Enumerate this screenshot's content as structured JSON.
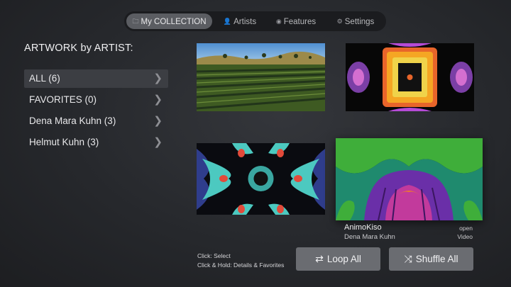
{
  "tabs": [
    {
      "icon": "folder-icon",
      "label": "My COLLECTION",
      "active": true
    },
    {
      "icon": "person-icon",
      "label": "Artists",
      "active": false
    },
    {
      "icon": "eye-icon",
      "label": "Features",
      "active": false
    },
    {
      "icon": "gear-icon",
      "label": "Settings",
      "active": false
    }
  ],
  "sidebar": {
    "heading": "ARTWORK by ARTIST:",
    "items": [
      {
        "label": "ALL (6)",
        "selected": true
      },
      {
        "label": "FAVORITES (0)",
        "selected": false
      },
      {
        "label": "Dena Mara Kuhn (3)",
        "selected": false
      },
      {
        "label": "Helmut Kuhn (3)",
        "selected": false
      }
    ]
  },
  "focused_artwork": {
    "title": "AnimoKiso",
    "artist": "Dena Mara Kuhn",
    "action": "open",
    "type": "Video"
  },
  "hints": {
    "line1": "Click: Select",
    "line2": "Click & Hold: Details & Favorites"
  },
  "buttons": {
    "loop_label": "Loop All",
    "shuffle_label": "Shuffle All"
  },
  "colors": {
    "background": "#26282c",
    "active_tab": "#5b5d62",
    "button": "#6a6c71",
    "selected_item": "#3c3e43"
  }
}
